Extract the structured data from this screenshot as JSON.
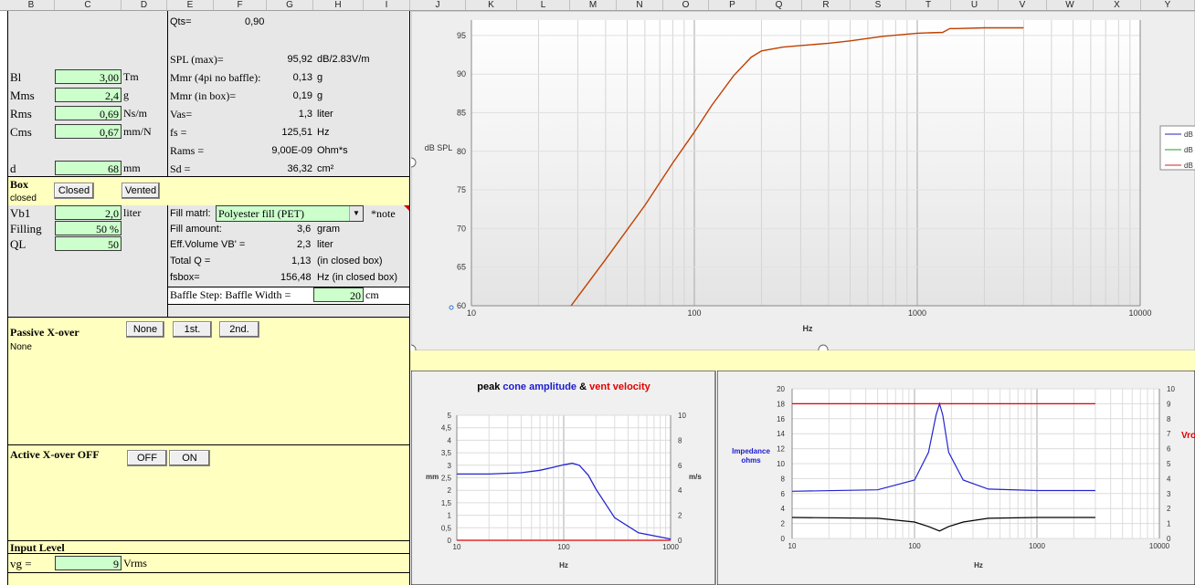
{
  "columns": [
    "B",
    "C",
    "D",
    "E",
    "F",
    "G",
    "H",
    "I",
    "J",
    "K",
    "L",
    "M",
    "N",
    "O",
    "P",
    "Q",
    "R",
    "S",
    "T",
    "U",
    "V",
    "W",
    "X",
    "Y"
  ],
  "params": {
    "qts_label": "Qts=",
    "qts_value": "0,90",
    "bl_label": "Bl",
    "bl_value": "3,00",
    "bl_unit": "Tm",
    "mms_label": "Mms",
    "mms_value": "2,4",
    "mms_unit": "g",
    "rms_label": "Rms",
    "rms_value": "0,69",
    "rms_unit": "Ns/m",
    "cms_label": "Cms",
    "cms_value": "0,67",
    "cms_unit": "mm/N",
    "d_label": "d",
    "d_value": "68",
    "d_unit": "mm"
  },
  "calc": [
    {
      "label": "SPL (max)=",
      "value": "95,92",
      "unit": "dB/2.83V/m"
    },
    {
      "label": "Mmr (4pi no baffle):",
      "value": "0,13",
      "unit": "g"
    },
    {
      "label": "Mmr (in box)=",
      "value": "0,19",
      "unit": "g"
    },
    {
      "label": "Vas=",
      "value": "1,3",
      "unit": "liter"
    },
    {
      "label": "fs =",
      "value": "125,51",
      "unit": "Hz"
    },
    {
      "label": "Rams =",
      "value": "9,00E-09",
      "unit": "Ohm*s"
    },
    {
      "label": "Sd =",
      "value": "36,32",
      "unit": "cm²"
    }
  ],
  "box": {
    "title": "Box",
    "type": "closed",
    "closed_btn": "Closed",
    "vented_btn": "Vented",
    "vb1_label": "Vb1",
    "vb1_value": "2,0",
    "vb1_unit": "liter",
    "filling_label": "Filling",
    "filling_value": "50 %",
    "ql_label": "QL",
    "ql_value": "50",
    "fill_matrl_label": "Fill matrl:",
    "fill_matrl_value": "Polyester fill (PET)",
    "note": "*note",
    "fill_amount_label": "Fill amount:",
    "fill_amount_value": "3,6",
    "fill_amount_unit": "gram",
    "eff_vol_label": "Eff.Volume VB' =",
    "eff_vol_value": "2,3",
    "eff_vol_unit": "liter",
    "total_q_label": "Total Q =",
    "total_q_value": "1,13",
    "total_q_unit": "(in closed box)",
    "fsbox_label": "fsbox=",
    "fsbox_value": "156,48",
    "fsbox_unit": "Hz  (in closed box)",
    "baffle_label": "Baffle Step:   Baffle Width  =",
    "baffle_value": "20",
    "baffle_unit": "cm"
  },
  "passive": {
    "title": "Passive X-over",
    "state": "None",
    "btn_none": "None",
    "btn_1st": "1st.",
    "btn_2nd": "2nd."
  },
  "active": {
    "title": "Active X-over OFF",
    "btn_off": "OFF",
    "btn_on": "ON"
  },
  "input": {
    "title": "Input Level",
    "vg_label": "vg =",
    "vg_value": "9",
    "vg_unit": "Vrms"
  },
  "spl_chart": {
    "ylabel": "dB SPL",
    "xlabel": "Hz",
    "yticks": [
      "95",
      "90",
      "85",
      "80",
      "75",
      "70",
      "65",
      "60"
    ],
    "xticks": [
      "10",
      "100",
      "1000",
      "10000"
    ],
    "legend": [
      "dB",
      "dB",
      "dB"
    ],
    "colors": {
      "line": "#c04000"
    }
  },
  "cone_chart": {
    "title_parts": [
      "peak ",
      "cone amplitude",
      " & ",
      "vent velocity"
    ],
    "ylabel_left": "mm",
    "ylabel_right": "m/s",
    "xlabel": "Hz",
    "yticks_left": [
      "5",
      "4,5",
      "4",
      "3,5",
      "3",
      "2,5",
      "2",
      "1,5",
      "1",
      "0,5",
      "0"
    ],
    "yticks_right": [
      "10",
      "8",
      "6",
      "4",
      "2",
      "0"
    ],
    "xticks": [
      "10",
      "100",
      "1000"
    ]
  },
  "imp_chart": {
    "ylabel": "Impedance ohms",
    "xlabel": "Hz",
    "right_label": "Vro",
    "yticks_left": [
      "20",
      "18",
      "16",
      "14",
      "12",
      "10",
      "8",
      "6",
      "4",
      "2",
      "0"
    ],
    "yticks_right": [
      "10",
      "9",
      "8",
      "7",
      "6",
      "5",
      "4",
      "3",
      "2",
      "1",
      "0"
    ],
    "xticks": [
      "10",
      "100",
      "1000",
      "10000"
    ]
  },
  "chart_data": [
    {
      "type": "line",
      "title": "",
      "xlabel": "Hz",
      "ylabel": "dB SPL",
      "xscale": "log",
      "xlim": [
        10,
        10000
      ],
      "ylim": [
        60,
        97
      ],
      "grid": true,
      "legend": "right",
      "series": [
        {
          "x": [
            28,
            40,
            60,
            80,
            100,
            120,
            150,
            180,
            200,
            250,
            300,
            400,
            500,
            700,
            1000,
            1300,
            1400,
            1500,
            2000,
            3000
          ],
          "y": [
            60,
            66,
            73,
            78.5,
            82.5,
            86,
            89.8,
            92.2,
            93,
            93.5,
            93.7,
            94,
            94.3,
            94.9,
            95.3,
            95.4,
            95.9,
            95.9,
            96,
            96
          ]
        }
      ]
    },
    {
      "type": "line",
      "title": "peak cone amplitude & vent velocity",
      "xlabel": "Hz",
      "ylabel": "mm",
      "xscale": "log",
      "xlim": [
        10,
        1000
      ],
      "ylim": [
        0,
        5
      ],
      "grid": true,
      "series": [
        {
          "x": [
            10,
            20,
            40,
            60,
            80,
            100,
            120,
            140,
            170,
            200,
            300,
            500,
            1000
          ],
          "y": [
            2.65,
            2.65,
            2.7,
            2.8,
            2.92,
            3.02,
            3.08,
            3.0,
            2.6,
            2.05,
            0.9,
            0.3,
            0.05
          ]
        },
        {
          "x": [
            10,
            1000
          ],
          "y": [
            0,
            0
          ]
        }
      ]
    },
    {
      "type": "line",
      "title": "",
      "xlabel": "Hz",
      "ylabel": "Impedance ohms",
      "xscale": "log",
      "xlim": [
        10,
        10000
      ],
      "ylim": [
        0,
        20
      ],
      "grid": true,
      "series": [
        {
          "x": [
            10,
            50,
            100,
            130,
            150,
            160,
            170,
            190,
            250,
            400,
            1000,
            3000
          ],
          "y": [
            6.3,
            6.5,
            7.8,
            11.5,
            16.5,
            18,
            16.5,
            11.5,
            7.8,
            6.6,
            6.4,
            6.4
          ]
        },
        {
          "x": [
            10,
            3000
          ],
          "y": [
            18,
            18
          ]
        },
        {
          "x": [
            10,
            50,
            100,
            130,
            160,
            190,
            250,
            400,
            1000,
            3000
          ],
          "y": [
            2.8,
            2.7,
            2.2,
            1.6,
            1.0,
            1.6,
            2.2,
            2.7,
            2.8,
            2.8
          ]
        }
      ]
    }
  ]
}
